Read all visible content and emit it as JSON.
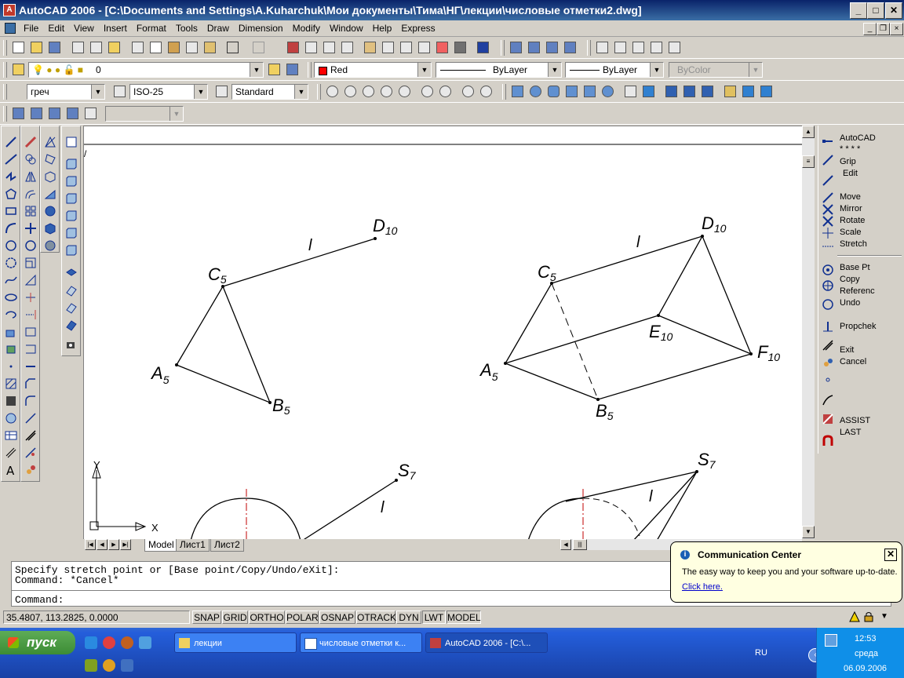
{
  "window": {
    "title": "AutoCAD 2006 - [C:\\Documents and Settings\\A.Kuharchuk\\Мои документы\\Тима\\НГ\\лекции\\числовые отметки2.dwg]",
    "minimize": "_",
    "maximize": "□",
    "close": "✕"
  },
  "menu": [
    "File",
    "Edit",
    "View",
    "Insert",
    "Format",
    "Tools",
    "Draw",
    "Dimension",
    "Modify",
    "Window",
    "Help",
    "Express"
  ],
  "layers": {
    "layer_name": "0",
    "color": "Red",
    "color_hex": "#ff0000",
    "linetype": "ByLayer",
    "lineweight": "ByLayer",
    "plotstyle": "ByColor"
  },
  "styles": {
    "text_style": "греч",
    "dim_style": "ISO-25",
    "table_style": "Standard"
  },
  "grip_menu": {
    "header": [
      "AutoCAD",
      "* * * *",
      "Grip",
      "Edit"
    ],
    "items": [
      "Move",
      "Mirror",
      "Rotate",
      "Scale",
      "Stretch",
      "Base Pt",
      "Copy",
      "Referenc",
      "Undo",
      "Propchek",
      "Exit",
      "Cancel",
      "ASSIST",
      "LAST"
    ]
  },
  "drawing": {
    "left_figure": {
      "C": "C",
      "C_sub": "5",
      "D": "D",
      "D_sub": "10",
      "A": "A",
      "A_sub": "5",
      "B": "B",
      "B_sub": "5",
      "l": "l"
    },
    "right_figure": {
      "C": "C",
      "C_sub": "5",
      "D": "D",
      "D_sub": "10",
      "A": "A",
      "A_sub": "5",
      "B": "B",
      "B_sub": "5",
      "E": "E",
      "E_sub": "10",
      "F": "F",
      "F_sub": "10",
      "l": "l"
    },
    "bottom_left": {
      "S": "S",
      "S_sub": "7",
      "l": "l"
    },
    "bottom_right": {
      "S": "S",
      "S_sub": "7",
      "l": "l"
    },
    "ucs": {
      "x": "X",
      "y": "Y"
    }
  },
  "layout_tabs": [
    "Model",
    "Лист1",
    "Лист2"
  ],
  "command": {
    "line1": "Specify stretch point or [Base point/Copy/Undo/eXit]:",
    "line2": "Command: *Cancel*",
    "line3": "Command:"
  },
  "status": {
    "coords": "35.4807, 113.2825, 0.0000",
    "buttons": [
      "SNAP",
      "GRID",
      "ORTHO",
      "POLAR",
      "OSNAP",
      "OTRACK",
      "DYN",
      "LWT",
      "MODEL"
    ]
  },
  "balloon": {
    "title": "Communication Center",
    "body": "The easy way to keep you and your software up-to-date.",
    "link": "Click here.",
    "close": "✕"
  },
  "taskbar": {
    "start": "пуск",
    "tasks": [
      "лекции",
      "числовые отметки к...",
      "AutoCAD 2006 - [C:\\..."
    ],
    "lang": "RU",
    "time": "12:53",
    "day": "среда",
    "date": "06.09.2006"
  }
}
